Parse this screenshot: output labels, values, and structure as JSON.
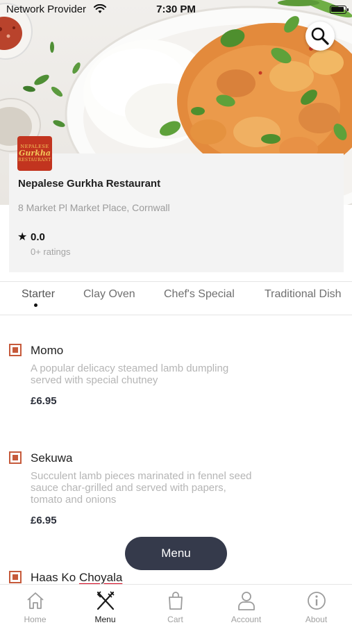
{
  "status_bar": {
    "carrier": "Network Provider",
    "time": "7:30 PM"
  },
  "restaurant": {
    "logo_lines": [
      "NEPALESE",
      "Gurkha",
      "RESTAURANT"
    ],
    "name": "Nepalese Gurkha Restaurant",
    "address": "8 Market Pl Market Place, Cornwall",
    "rating_star": "★",
    "rating": "0.0",
    "rating_count": "0+ ratings"
  },
  "tabs": [
    "Starter",
    "Clay Oven",
    "Chef's Special",
    "Traditional Dish"
  ],
  "menu_items": [
    {
      "name": "Momo",
      "description": "A popular delicacy steamed lamb dumpling served with special chutney",
      "price": "£6.95"
    },
    {
      "name": "Sekuwa",
      "description": "Succulent lamb pieces marinated in fennel seed sauce char-grilled and served with papers, tomato and onions",
      "price": "£6.95"
    },
    {
      "name_part1": "Haas Ko ",
      "name_part2": "Choyala"
    }
  ],
  "menu_button": "Menu",
  "bottom_nav": [
    {
      "label": "Home",
      "icon": "home-icon"
    },
    {
      "label": "Menu",
      "icon": "fork-knife-icon"
    },
    {
      "label": "Cart",
      "icon": "shopping-bag-icon"
    },
    {
      "label": "Account",
      "icon": "person-icon"
    },
    {
      "label": "About",
      "icon": "info-icon"
    }
  ],
  "colors": {
    "accent": "#c65a3b",
    "brand_dark": "#353a4b",
    "logo_red": "#c2341f"
  }
}
